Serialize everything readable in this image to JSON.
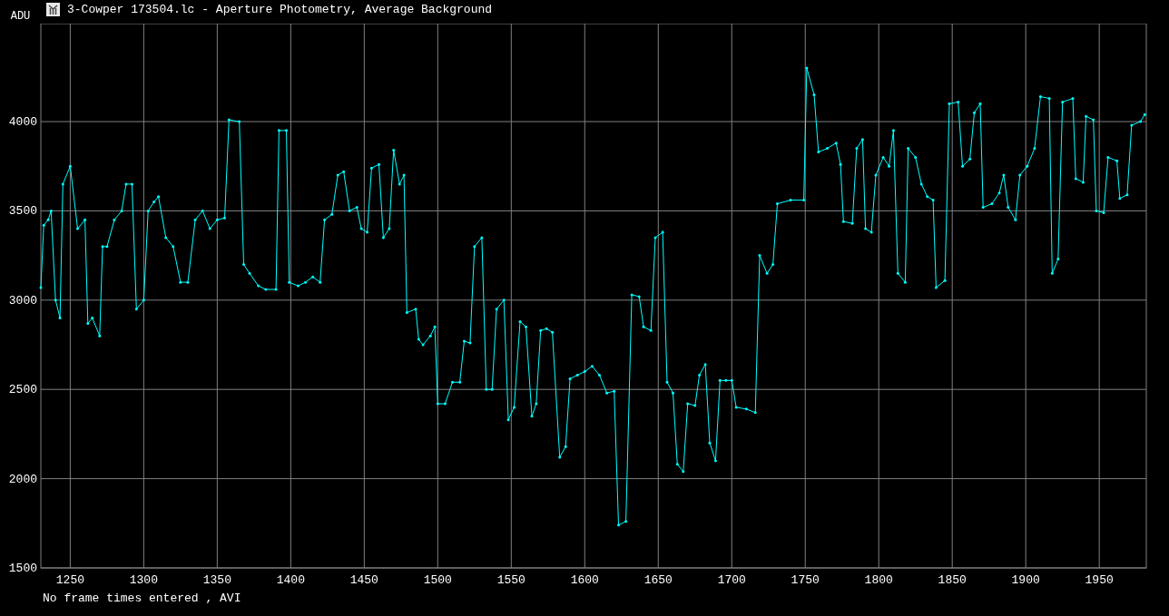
{
  "window": {
    "title": "3-Cowper 173504.lc - Aperture Photometry, Average Background"
  },
  "plot": {
    "chart_data": {
      "type": "line",
      "grid": true,
      "ylabel": "ADU",
      "xlim": [
        1230,
        1982
      ],
      "ylim": [
        1500,
        4549
      ],
      "xticks": [
        1250,
        1300,
        1350,
        1400,
        1450,
        1500,
        1550,
        1600,
        1650,
        1700,
        1750,
        1800,
        1850,
        1900,
        1950
      ],
      "yticks": [
        1500,
        2000,
        2500,
        3000,
        3500,
        4000
      ],
      "x": [
        1230,
        1232,
        1235,
        1237,
        1240,
        1243,
        1245,
        1250,
        1255,
        1260,
        1262,
        1265,
        1270,
        1272,
        1275,
        1280,
        1285,
        1288,
        1292,
        1295,
        1300,
        1303,
        1307,
        1310,
        1315,
        1320,
        1325,
        1330,
        1335,
        1340,
        1345,
        1350,
        1355,
        1358,
        1365,
        1368,
        1372,
        1378,
        1383,
        1390,
        1392,
        1397,
        1399,
        1405,
        1410,
        1415,
        1420,
        1423,
        1428,
        1432,
        1436,
        1440,
        1445,
        1448,
        1452,
        1455,
        1460,
        1463,
        1467,
        1470,
        1474,
        1477,
        1479,
        1485,
        1487,
        1490,
        1495,
        1498,
        1500,
        1505,
        1510,
        1515,
        1518,
        1522,
        1525,
        1530,
        1533,
        1537,
        1540,
        1545,
        1548,
        1552,
        1556,
        1560,
        1564,
        1567,
        1570,
        1574,
        1578,
        1583,
        1587,
        1590,
        1595,
        1600,
        1605,
        1610,
        1615,
        1620,
        1623,
        1628,
        1632,
        1637,
        1640,
        1645,
        1648,
        1653,
        1656,
        1660,
        1663,
        1667,
        1670,
        1675,
        1678,
        1682,
        1685,
        1689,
        1692,
        1696,
        1700,
        1703,
        1710,
        1716,
        1719,
        1724,
        1728,
        1731,
        1740,
        1749,
        1751,
        1756,
        1759,
        1765,
        1771,
        1774,
        1776,
        1782,
        1785,
        1789,
        1791,
        1795,
        1798,
        1803,
        1807,
        1810,
        1813,
        1818,
        1820,
        1825,
        1829,
        1833,
        1837,
        1839,
        1845,
        1848,
        1854,
        1857,
        1862,
        1865,
        1869,
        1871,
        1877,
        1882,
        1885,
        1888,
        1893,
        1896,
        1901,
        1906,
        1910,
        1916,
        1918,
        1922,
        1925,
        1932,
        1934,
        1939,
        1941,
        1946,
        1948,
        1953,
        1956,
        1962,
        1964,
        1969,
        1972,
        1978,
        1981
      ],
      "series": [
        {
          "color": "#00ffff",
          "values": [
            3070,
            3420,
            3450,
            3500,
            3000,
            2900,
            3650,
            3750,
            3400,
            3450,
            2870,
            2900,
            2800,
            3300,
            3300,
            3450,
            3500,
            3650,
            3650,
            2950,
            3000,
            3500,
            3550,
            3580,
            3350,
            3300,
            3100,
            3100,
            3450,
            3500,
            3400,
            3450,
            3460,
            4010,
            4000,
            3200,
            3150,
            3080,
            3060,
            3060,
            3950,
            3950,
            3100,
            3080,
            3100,
            3130,
            3100,
            3450,
            3480,
            3700,
            3720,
            3500,
            3520,
            3400,
            3380,
            3740,
            3760,
            3350,
            3400,
            3840,
            3650,
            3700,
            2930,
            2950,
            2780,
            2750,
            2800,
            2850,
            2420,
            2420,
            2540,
            2540,
            2770,
            2760,
            3300,
            3350,
            2500,
            2500,
            2950,
            3000,
            2330,
            2400,
            2880,
            2850,
            2350,
            2420,
            2830,
            2840,
            2820,
            2120,
            2180,
            2560,
            2580,
            2600,
            2630,
            2580,
            2480,
            2490,
            1740,
            1760,
            3030,
            3020,
            2850,
            2830,
            3350,
            3380,
            2540,
            2480,
            2080,
            2040,
            2420,
            2410,
            2580,
            2640,
            2200,
            2100,
            2550,
            2550,
            2550,
            2400,
            2390,
            2370,
            3250,
            3150,
            3200,
            3540,
            3560,
            3560,
            4300,
            4150,
            3830,
            3850,
            3880,
            3760,
            3440,
            3430,
            3850,
            3900,
            3400,
            3380,
            3700,
            3800,
            3750,
            3950,
            3150,
            3100,
            3850,
            3800,
            3650,
            3580,
            3560,
            3070,
            3110,
            4100,
            4110,
            3750,
            3790,
            4050,
            4100,
            3520,
            3540,
            3600,
            3700,
            3520,
            3450,
            3700,
            3750,
            3850,
            4140,
            4130,
            3150,
            3230,
            4110,
            4130,
            3680,
            3660,
            4030,
            4010,
            3500,
            3490,
            3800,
            3780,
            3570,
            3590,
            3980,
            4000,
            4040
          ]
        }
      ]
    }
  },
  "status_bar": {
    "text": "No frame times entered , AVI"
  }
}
